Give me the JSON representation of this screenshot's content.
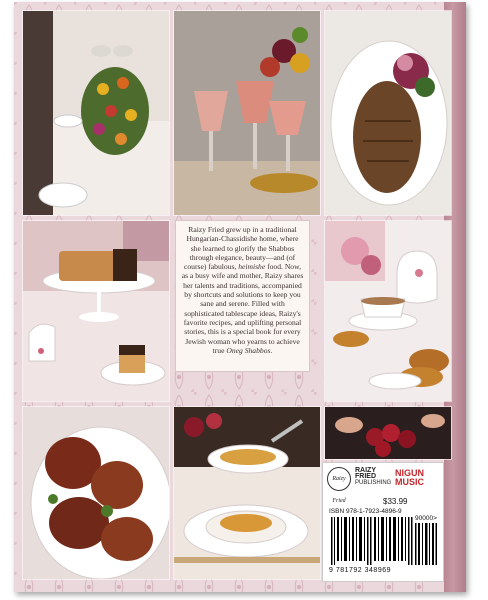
{
  "cover": {
    "colors": {
      "background": "#ead8dc",
      "spine": "#c799a5",
      "panel": "#fbf6f2"
    },
    "blurb": {
      "text": "Raizy Fried grew up in a traditional Hungarian-Chassidishe home, where she learned to glorify the Shabbos through elegance, beauty—and (of course) fabulous, ",
      "italic_word": "heimishe",
      "text2": " food. Now, as a busy wife and mother, Raizy shares her talents and traditions, accompanied by shortcuts and solutions to keep you sane and serene. Filled with sophisticated tablescape ideas, Raizy's favorite recipes, and uplifting personal stories, this is a special book for every Jewish woman who yearns to achieve true ",
      "italic_end": "Oneg Shabbos."
    },
    "logos": {
      "raizy_badge": "Raizy Fried",
      "publisher_name": "RAIZY FRIED",
      "publisher_sub": "PUBLISHING",
      "music_top": "NIGUN",
      "music_bottom": "MUSIC"
    },
    "price": "$33.99",
    "isbn": "ISBN 978-1-7923-4896-9",
    "supplement": "90000>",
    "ean": "9 781792 348969"
  }
}
